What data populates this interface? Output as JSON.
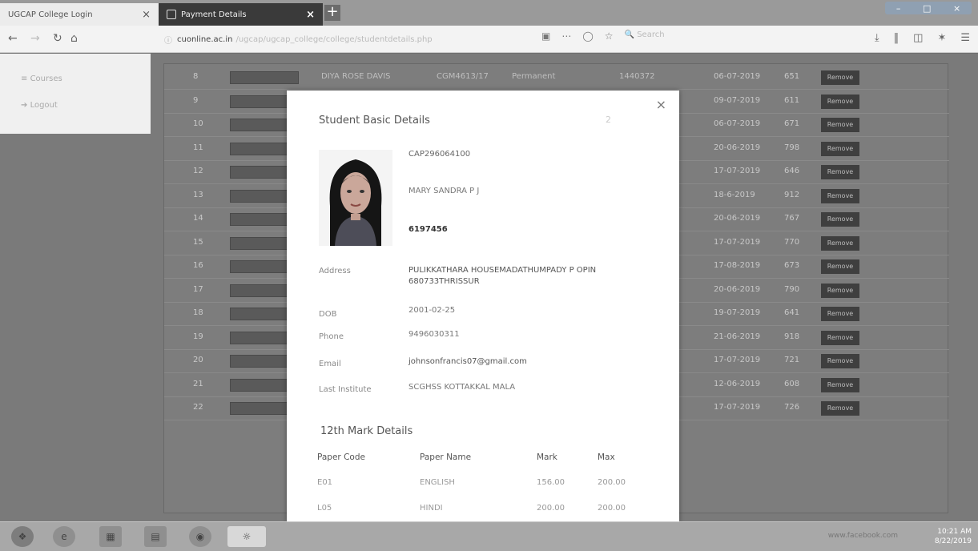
{
  "browser": {
    "tabs": [
      {
        "label": "UGCAP College Login",
        "close": "×"
      },
      {
        "label": "Payment Details",
        "close": "×"
      }
    ],
    "new_tab": "+",
    "window_controls": [
      "–",
      "□",
      "×"
    ],
    "url_host": "cuonline.ac.in",
    "url_rest": "/ugcap/ugcap_college/college/studentdetails.php",
    "search_placeholder": "Search"
  },
  "sidebar": {
    "items": [
      {
        "label": "Courses"
      },
      {
        "label": "Logout"
      }
    ]
  },
  "background_table": {
    "rows": [
      {
        "num": "8",
        "name": "DIYA ROSE DAVIS",
        "code": "CGM4613/17",
        "type": "Permanent",
        "id": "1440372",
        "date": "06-07-2019",
        "amount": "651",
        "action": "Remove"
      },
      {
        "num": "9",
        "name": "",
        "code": "",
        "type": "",
        "id": "",
        "date": "09-07-2019",
        "amount": "611",
        "action": "Remove"
      },
      {
        "num": "10",
        "name": "",
        "code": "",
        "type": "",
        "id": "",
        "date": "06-07-2019",
        "amount": "671",
        "action": "Remove"
      },
      {
        "num": "11",
        "name": "",
        "code": "",
        "type": "",
        "id": "",
        "date": "20-06-2019",
        "amount": "798",
        "action": "Remove"
      },
      {
        "num": "12",
        "name": "",
        "code": "",
        "type": "",
        "id": "",
        "date": "17-07-2019",
        "amount": "646",
        "action": "Remove"
      },
      {
        "num": "13",
        "name": "",
        "code": "",
        "type": "",
        "id": "",
        "date": "18-6-2019",
        "amount": "912",
        "action": "Remove"
      },
      {
        "num": "14",
        "name": "",
        "code": "",
        "type": "",
        "id": "",
        "date": "20-06-2019",
        "amount": "767",
        "action": "Remove"
      },
      {
        "num": "15",
        "name": "",
        "code": "",
        "type": "",
        "id": "",
        "date": "17-07-2019",
        "amount": "770",
        "action": "Remove"
      },
      {
        "num": "16",
        "name": "",
        "code": "",
        "type": "",
        "id": "",
        "date": "17-08-2019",
        "amount": "673",
        "action": "Remove"
      },
      {
        "num": "17",
        "name": "",
        "code": "",
        "type": "",
        "id": "",
        "date": "20-06-2019",
        "amount": "790",
        "action": "Remove"
      },
      {
        "num": "18",
        "name": "",
        "code": "",
        "type": "",
        "id": "",
        "date": "19-07-2019",
        "amount": "641",
        "action": "Remove"
      },
      {
        "num": "19",
        "name": "",
        "code": "",
        "type": "",
        "id": "",
        "date": "21-06-2019",
        "amount": "918",
        "action": "Remove"
      },
      {
        "num": "20",
        "name": "",
        "code": "",
        "type": "",
        "id": "",
        "date": "17-07-2019",
        "amount": "721",
        "action": "Remove"
      },
      {
        "num": "21",
        "name": "",
        "code": "",
        "type": "",
        "id": "",
        "date": "12-06-2019",
        "amount": "608",
        "action": "Remove"
      },
      {
        "num": "22",
        "name": "",
        "code": "",
        "type": "",
        "id": "",
        "date": "17-07-2019",
        "amount": "726",
        "action": "Remove"
      }
    ]
  },
  "modal": {
    "title": "Student Basic Details",
    "aside": "2",
    "close": "×",
    "application_no": "CAP296064100",
    "name": "MARY SANDRA P J",
    "reg_no": "6197456",
    "fields": [
      {
        "label": "Address",
        "value": "PULIKKATHARA HOUSEMADATHUMPADY P OPIN 680733THRISSUR"
      },
      {
        "label": "DOB",
        "value": "2001-02-25"
      },
      {
        "label": "Phone",
        "value": "9496030311"
      },
      {
        "label": "Email",
        "value": "johnsonfrancis07@gmail.com"
      },
      {
        "label": "Last Institute",
        "value": "SCGHSS KOTTAKKAL MALA"
      }
    ],
    "marks_title": "12th Mark Details",
    "marks_headers": [
      "Paper Code",
      "Paper Name",
      "Mark",
      "Max"
    ],
    "marks_rows": [
      [
        "E01",
        "ENGLISH",
        "156.00",
        "200.00"
      ],
      [
        "L05",
        "HINDI",
        "200.00",
        "200.00"
      ]
    ]
  },
  "taskbar": {
    "time": "10:21 AM",
    "date": "8/22/2019",
    "site_text": "www.facebook.com"
  }
}
